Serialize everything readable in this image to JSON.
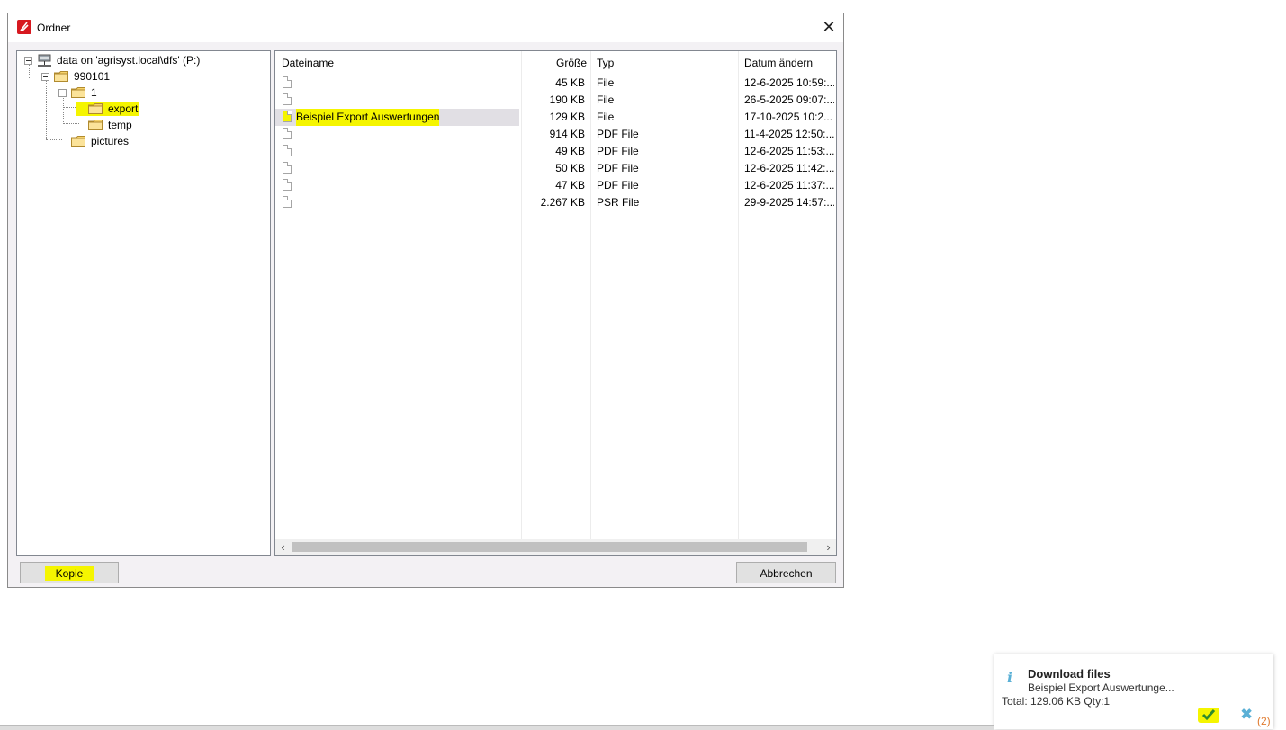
{
  "window": {
    "title": "Ordner"
  },
  "tree": {
    "root": "data on 'agrisyst.local\\dfs' (P:)",
    "nodes": [
      "990101",
      "1",
      "export",
      "temp",
      "pictures"
    ]
  },
  "list": {
    "columns": [
      "Dateiname",
      "Größe",
      "Typ",
      "Datum ändern"
    ],
    "rows": [
      {
        "name": "",
        "size": "45 KB",
        "type": "File",
        "date": "12-6-2025 10:59:..."
      },
      {
        "name": "",
        "size": "190 KB",
        "type": "File",
        "date": "26-5-2025 09:07:..."
      },
      {
        "name": "Beispiel Export Auswertungen",
        "size": "129 KB",
        "type": "File",
        "date": "17-10-2025 10:2...",
        "selected": true
      },
      {
        "name": "",
        "size": "914 KB",
        "type": "PDF File",
        "date": "11-4-2025 12:50:..."
      },
      {
        "name": "",
        "size": "49 KB",
        "type": "PDF File",
        "date": "12-6-2025 11:53:..."
      },
      {
        "name": "",
        "size": "50 KB",
        "type": "PDF File",
        "date": "12-6-2025 11:42:..."
      },
      {
        "name": "",
        "size": "47 KB",
        "type": "PDF File",
        "date": "12-6-2025 11:37:..."
      },
      {
        "name": "",
        "size": "2.267 KB",
        "type": "PSR File",
        "date": "29-9-2025 14:57:..."
      }
    ]
  },
  "buttons": {
    "copy": "Kopie",
    "cancel": "Abbrechen"
  },
  "notification": {
    "title": "Download files",
    "file": "Beispiel Export Auswertunge...",
    "total": "Total: 129.06 KB Qty:1",
    "count": "(2)"
  },
  "colors": {
    "highlight": "#f5f500",
    "accent": "#5ab0d6",
    "app_icon": "#d71920"
  }
}
